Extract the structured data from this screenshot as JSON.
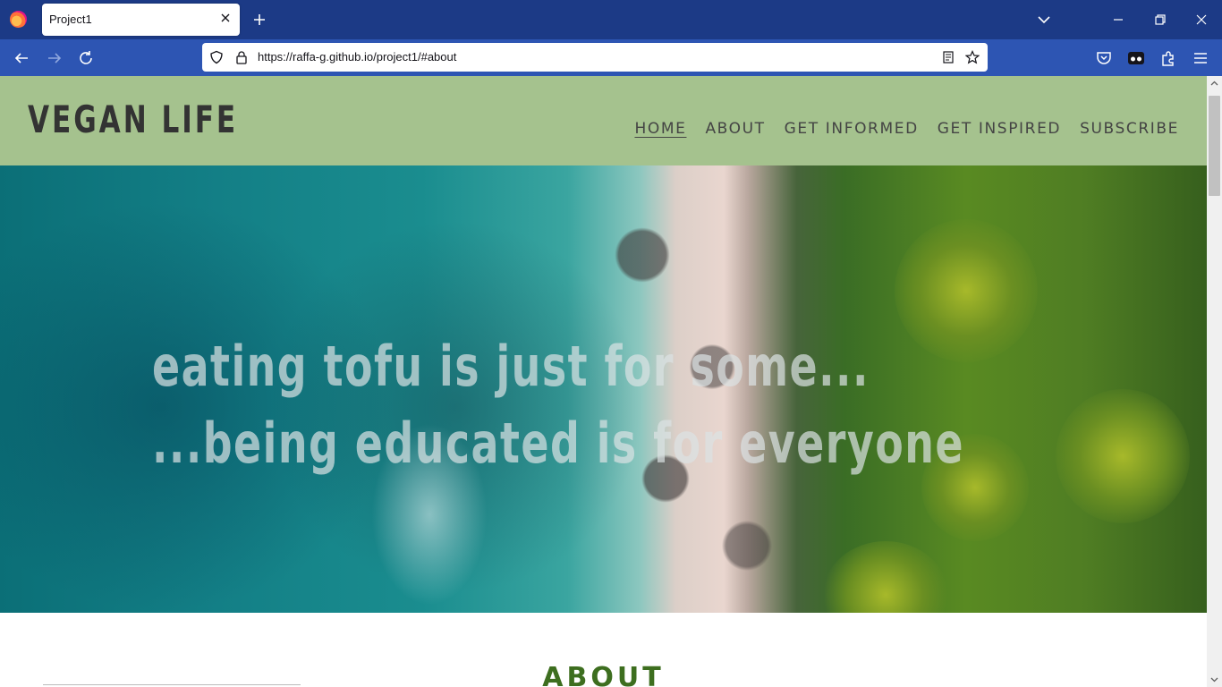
{
  "browser": {
    "tab_title": "Project1",
    "url": "https://raffa-g.github.io/project1/#about"
  },
  "site": {
    "logo": "VEGAN LIFE",
    "menu": [
      {
        "label": "HOME",
        "active": true
      },
      {
        "label": "ABOUT",
        "active": false
      },
      {
        "label": "GET INFORMED",
        "active": false
      },
      {
        "label": "GET INSPIRED",
        "active": false
      },
      {
        "label": "SUBSCRIBE",
        "active": false
      }
    ],
    "hero": {
      "line1": "eating tofu is just for some...",
      "line2": "...being educated is for everyone"
    },
    "about_heading": "ABOUT"
  },
  "colors": {
    "tabbar": "#1c3a86",
    "navbar": "#2d55b3",
    "header_bg": "#a5c28e",
    "logo_text": "#333333",
    "about_heading": "#3d6e1f"
  },
  "icons": [
    "firefox-logo-icon",
    "close-icon",
    "plus-icon",
    "chevron-down-icon",
    "minimize-icon",
    "restore-icon",
    "back-icon",
    "forward-icon",
    "reload-icon",
    "shield-icon",
    "lock-icon",
    "reader-view-icon",
    "star-icon",
    "pocket-icon",
    "mask-icon",
    "extensions-icon",
    "menu-icon"
  ]
}
